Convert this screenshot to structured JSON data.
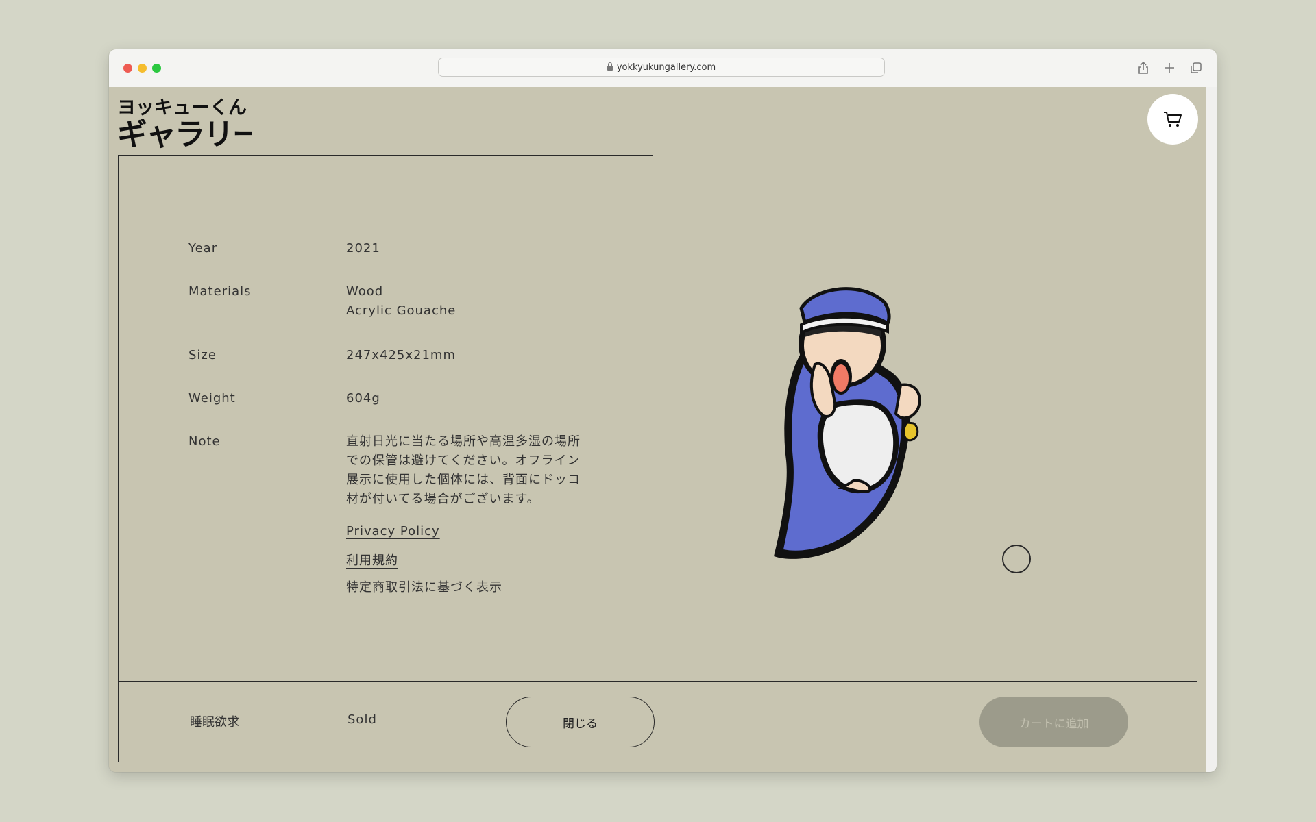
{
  "browser": {
    "url": "yokkyukungallery.com"
  },
  "site": {
    "logo_line1": "ヨッキューくん",
    "logo_line2": "ギャラリー"
  },
  "specs": {
    "year_label": "Year",
    "year_value": "2021",
    "materials_label": "Materials",
    "materials_value_1": "Wood",
    "materials_value_2": "Acrylic Gouache",
    "size_label": "Size",
    "size_value": "247x425x21mm",
    "weight_label": "Weight",
    "weight_value": "604g",
    "note_label": "Note",
    "note_value": "直射日光に当たる場所や高温多湿の場所での保管は避けてください。オフライン展示に使用した個体には、背面にドッコ材が付いてる場合がございます。"
  },
  "links": {
    "privacy": "Privacy Policy",
    "terms": "利用規約",
    "commerce": "特定商取引法に基づく表示"
  },
  "footer": {
    "title": "睡眠欲求",
    "status": "Sold",
    "close_label": "閉じる",
    "add_to_cart_label": "カートに追加"
  },
  "icons": {
    "cart": "cart-icon",
    "share": "share-icon",
    "new_tab": "plus-icon",
    "tabs": "tabs-overview-icon",
    "lock": "lock-icon"
  },
  "colors": {
    "page_bg": "#c8c5b1",
    "outer_bg": "#d4d6c7",
    "disabled_button": "#9c9b8b"
  }
}
